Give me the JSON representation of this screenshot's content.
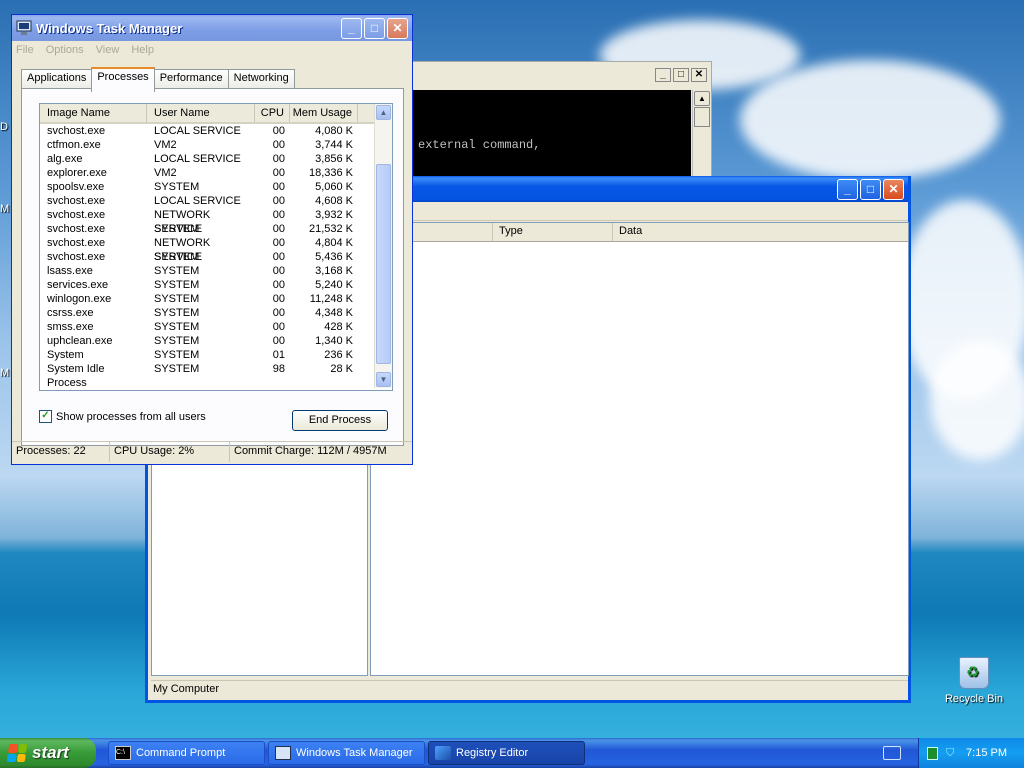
{
  "desktop": {
    "recycle_bin_label": "Recycle Bin",
    "edge_letters": [
      "D",
      "M",
      "M"
    ]
  },
  "cmd_window": {
    "visible_text": "external command,"
  },
  "regedit": {
    "columns": [
      "Type",
      "Data"
    ],
    "status": "My Computer"
  },
  "taskmgr": {
    "title": "Windows Task Manager",
    "menu": [
      "File",
      "Options",
      "View",
      "Help"
    ],
    "tabs": [
      "Applications",
      "Processes",
      "Performance",
      "Networking"
    ],
    "active_tab": "Processes",
    "columns": {
      "image": "Image Name",
      "user": "User Name",
      "cpu": "CPU",
      "mem": "Mem Usage"
    },
    "processes": [
      {
        "image": "svchost.exe",
        "user": "LOCAL SERVICE",
        "cpu": "00",
        "mem": "4,080 K"
      },
      {
        "image": "ctfmon.exe",
        "user": "VM2",
        "cpu": "00",
        "mem": "3,744 K"
      },
      {
        "image": "alg.exe",
        "user": "LOCAL SERVICE",
        "cpu": "00",
        "mem": "3,856 K"
      },
      {
        "image": "explorer.exe",
        "user": "VM2",
        "cpu": "00",
        "mem": "18,336 K"
      },
      {
        "image": "spoolsv.exe",
        "user": "SYSTEM",
        "cpu": "00",
        "mem": "5,060 K"
      },
      {
        "image": "svchost.exe",
        "user": "LOCAL SERVICE",
        "cpu": "00",
        "mem": "4,608 K"
      },
      {
        "image": "svchost.exe",
        "user": "NETWORK SERVICE",
        "cpu": "00",
        "mem": "3,932 K"
      },
      {
        "image": "svchost.exe",
        "user": "SYSTEM",
        "cpu": "00",
        "mem": "21,532 K"
      },
      {
        "image": "svchost.exe",
        "user": "NETWORK SERVICE",
        "cpu": "00",
        "mem": "4,804 K"
      },
      {
        "image": "svchost.exe",
        "user": "SYSTEM",
        "cpu": "00",
        "mem": "5,436 K"
      },
      {
        "image": "lsass.exe",
        "user": "SYSTEM",
        "cpu": "00",
        "mem": "3,168 K"
      },
      {
        "image": "services.exe",
        "user": "SYSTEM",
        "cpu": "00",
        "mem": "5,240 K"
      },
      {
        "image": "winlogon.exe",
        "user": "SYSTEM",
        "cpu": "00",
        "mem": "11,248 K"
      },
      {
        "image": "csrss.exe",
        "user": "SYSTEM",
        "cpu": "00",
        "mem": "4,348 K"
      },
      {
        "image": "smss.exe",
        "user": "SYSTEM",
        "cpu": "00",
        "mem": "428 K"
      },
      {
        "image": "uphclean.exe",
        "user": "SYSTEM",
        "cpu": "00",
        "mem": "1,340 K"
      },
      {
        "image": "System",
        "user": "SYSTEM",
        "cpu": "01",
        "mem": "236 K"
      },
      {
        "image": "System Idle Process",
        "user": "SYSTEM",
        "cpu": "98",
        "mem": "28 K"
      }
    ],
    "show_all_label": "Show processes from all users",
    "show_all_checked": true,
    "end_process_label": "End Process",
    "status": {
      "processes": "Processes: 22",
      "cpu": "CPU Usage: 2%",
      "commit": "Commit Charge: 112M / 4957M"
    }
  },
  "taskbar": {
    "start_label": "start",
    "items": [
      {
        "label": "Command Prompt",
        "icon": "cmd-icon"
      },
      {
        "label": "Windows Task Manager",
        "icon": "taskmgr-icon"
      },
      {
        "label": "Registry Editor",
        "icon": "regedit-icon",
        "active": true
      }
    ],
    "clock": "7:15 PM",
    "colors": {
      "start_green": "#379a37",
      "taskbar_blue": "#2157d7",
      "tray_blue": "#149ef0"
    }
  }
}
